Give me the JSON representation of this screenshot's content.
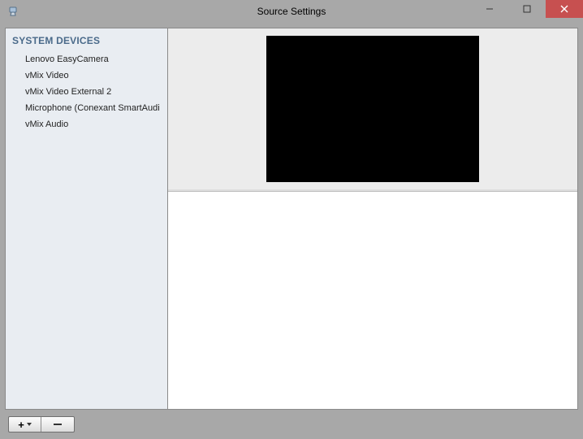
{
  "window": {
    "title": "Source Settings"
  },
  "sidebar": {
    "header": "SYSTEM DEVICES",
    "items": [
      "Lenovo EasyCamera",
      "vMix Video",
      "vMix Video External 2",
      "Microphone (Conexant SmartAudi",
      "vMix Audio"
    ]
  },
  "colors": {
    "close_bg": "#c75050",
    "chrome_bg": "#a8a8a8",
    "sidebar_bg": "#e9edf2",
    "header_fg": "#4a6a8a"
  }
}
